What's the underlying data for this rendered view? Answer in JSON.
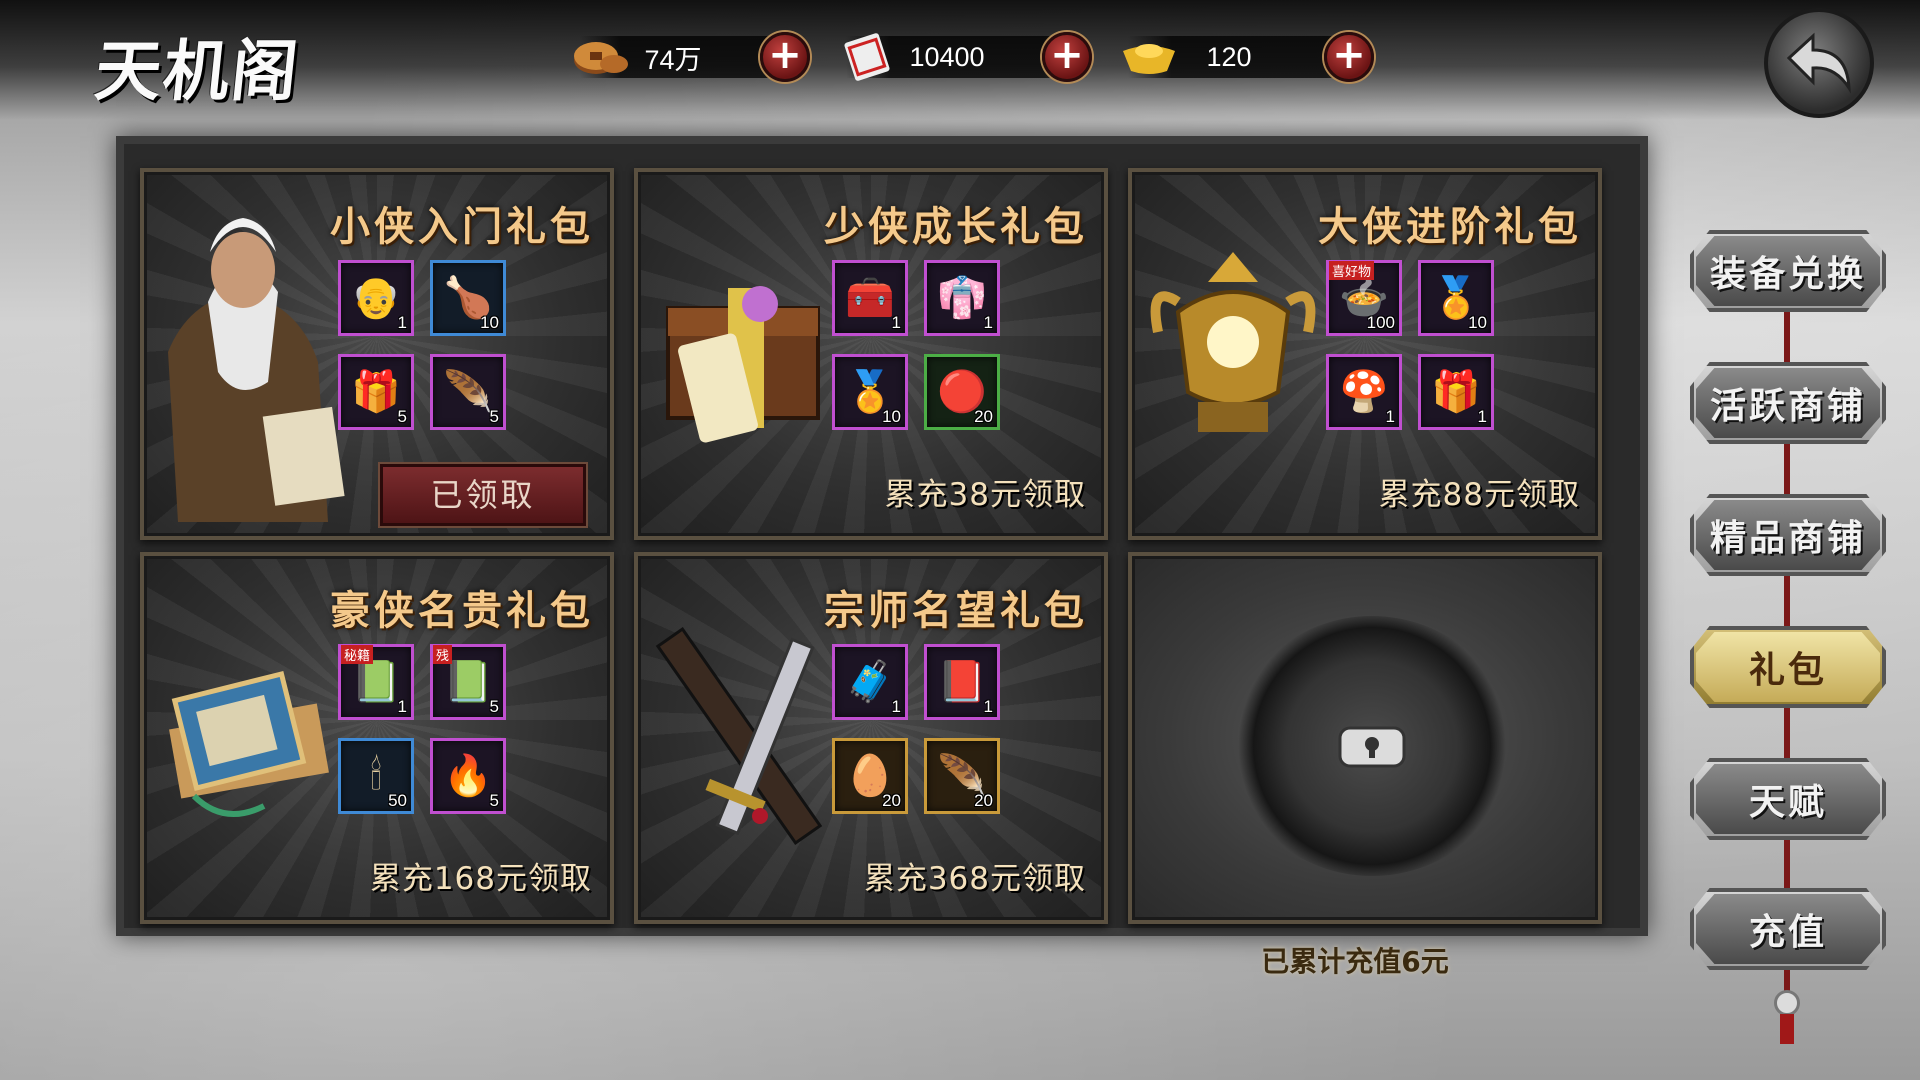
{
  "header": {
    "title": "天机阁",
    "resources": [
      {
        "icon": "copper-coin-icon",
        "value": "74万"
      },
      {
        "icon": "scroll-ticket-icon",
        "value": "10400"
      },
      {
        "icon": "gold-ingot-icon",
        "value": "120"
      }
    ]
  },
  "packs": [
    {
      "title": "小侠入门礼包",
      "status": "已领取",
      "items": [
        {
          "icon": "hero-card-icon",
          "qty": "1"
        },
        {
          "icon": "roast-chicken-icon",
          "qty": "10"
        },
        {
          "icon": "treasure-box-icon",
          "qty": "5"
        },
        {
          "icon": "golden-feather-icon",
          "qty": "5"
        }
      ]
    },
    {
      "title": "少侠成长礼包",
      "claim": "累充38元领取",
      "items": [
        {
          "icon": "golden-chest-icon",
          "qty": "1"
        },
        {
          "icon": "purple-robe-icon",
          "qty": "1"
        },
        {
          "icon": "gold-token-icon",
          "qty": "10"
        },
        {
          "icon": "red-pills-icon",
          "qty": "20"
        }
      ]
    },
    {
      "title": "大侠进阶礼包",
      "claim": "累充88元领取",
      "items": [
        {
          "icon": "food-plate-icon",
          "qty": "100",
          "tag": "喜好物"
        },
        {
          "icon": "gold-token-icon",
          "qty": "10"
        },
        {
          "icon": "lingzhi-mushroom-icon",
          "qty": "1"
        },
        {
          "icon": "treasure-box-icon",
          "qty": "1"
        }
      ]
    },
    {
      "title": "豪侠名贵礼包",
      "claim": "累充168元领取",
      "items": [
        {
          "icon": "secret-manual-icon",
          "qty": "1",
          "tag": "秘籍"
        },
        {
          "icon": "manual-fragment-icon",
          "qty": "5",
          "tag": "残"
        },
        {
          "icon": "incense-sticks-icon",
          "qty": "50"
        },
        {
          "icon": "fire-orb-icon",
          "qty": "5"
        }
      ]
    },
    {
      "title": "宗师名望礼包",
      "claim": "累充368元领取",
      "items": [
        {
          "icon": "wooden-chest-icon",
          "qty": "1"
        },
        {
          "icon": "armor-book-icon",
          "qty": "1"
        },
        {
          "icon": "phoenix-egg-icon",
          "qty": "20"
        },
        {
          "icon": "red-feather-icon",
          "qty": "20"
        }
      ]
    }
  ],
  "locked_slot": {
    "icon": "lock-icon"
  },
  "total_recharge": "已累计充值6元",
  "side_menu": [
    {
      "label": "装备兑换",
      "active": false
    },
    {
      "label": "活跃商铺",
      "active": false
    },
    {
      "label": "精品商铺",
      "active": false
    },
    {
      "label": "礼包",
      "active": true
    },
    {
      "label": "天赋",
      "active": false
    },
    {
      "label": "充值",
      "active": false
    }
  ],
  "colors": {
    "panel_title": "#f4c98b",
    "purple_frame": "#c04fd0",
    "blue_frame": "#3f8ad6",
    "green_frame": "#4cae46",
    "gold_frame": "#c99a3a",
    "claimed_button": "#7c2c2e",
    "active_tab": "#f0e4a6"
  }
}
